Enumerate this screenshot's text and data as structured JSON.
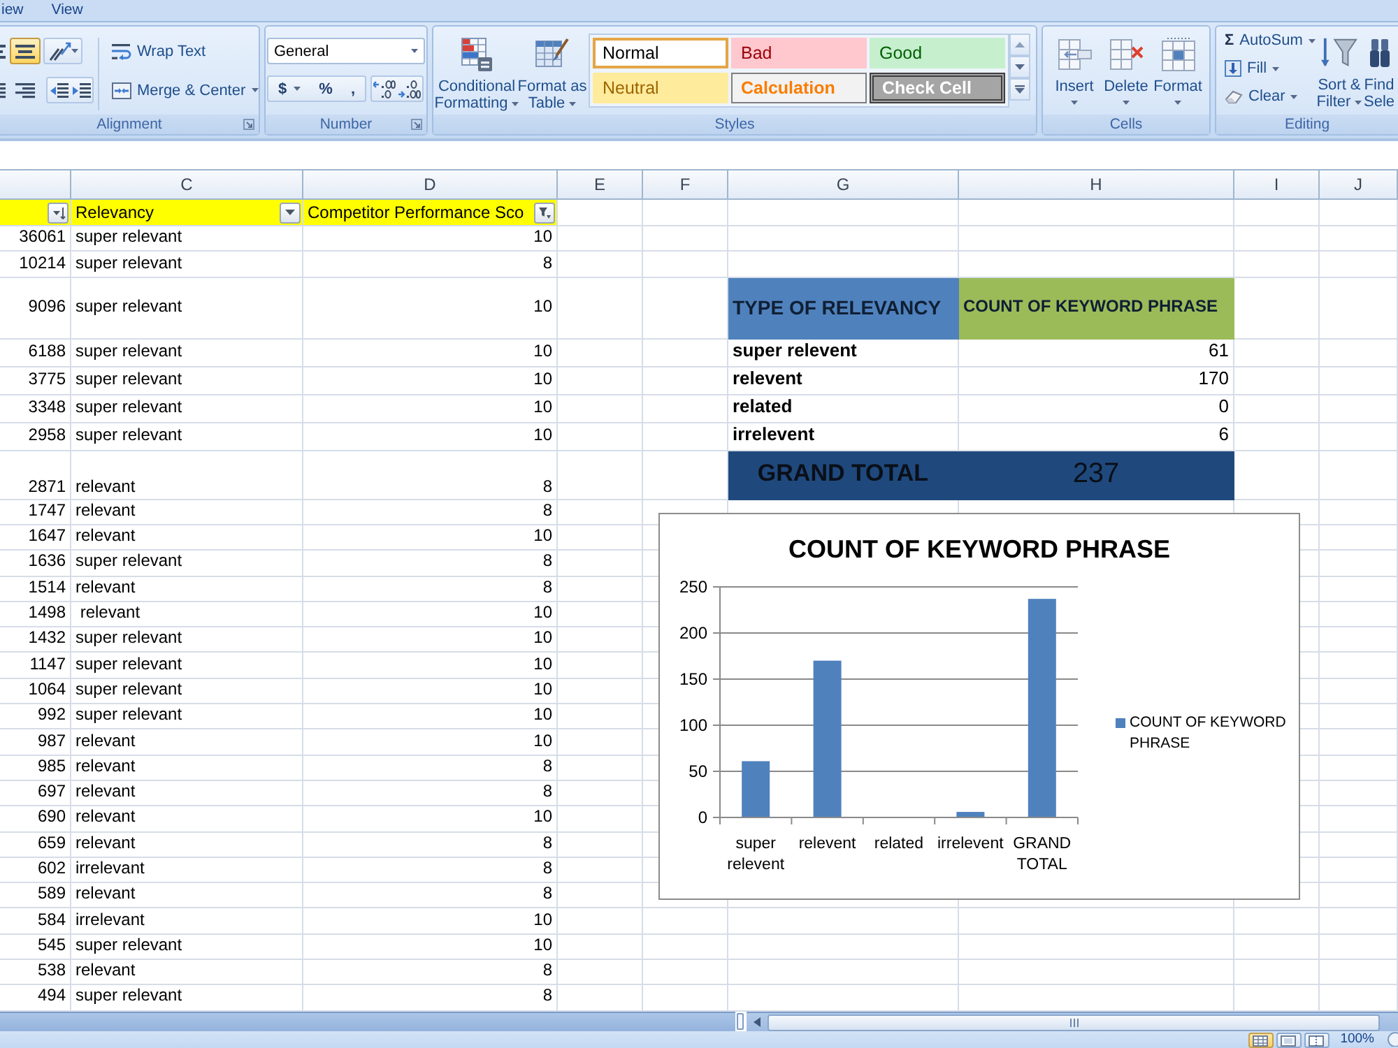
{
  "ribbon": {
    "tabs": [
      {
        "label": "iew",
        "selected": false
      },
      {
        "label": "View",
        "selected": false
      }
    ],
    "alignment": {
      "label": "Alignment",
      "vertical_align": [
        {
          "selected": false
        },
        {
          "selected": true
        }
      ],
      "horizontal_align": [
        {
          "selected": false
        },
        {
          "selected": false
        }
      ],
      "wrap_text": "Wrap Text",
      "merge_center": "Merge & Center"
    },
    "number": {
      "label": "Number",
      "format": "General",
      "currency": "$",
      "percent": "%",
      "comma": ","
    },
    "styles": {
      "label": "Styles",
      "conditional_formatting": [
        "Conditional",
        "Formatting"
      ],
      "format_as_table": [
        "Format as",
        "Table"
      ],
      "cell_styles": [
        {
          "label": "Normal",
          "kind": "normal",
          "selected": true
        },
        {
          "label": "Bad",
          "kind": "bad",
          "selected": false
        },
        {
          "label": "Good",
          "kind": "good",
          "selected": false
        },
        {
          "label": "Neutral",
          "kind": "neutral",
          "selected": false
        },
        {
          "label": "Calculation",
          "kind": "calculation",
          "selected": false
        },
        {
          "label": "Check Cell",
          "kind": "check",
          "selected": false
        }
      ]
    },
    "cells": {
      "label": "Cells",
      "buttons": [
        "Insert",
        "Delete",
        "Format"
      ]
    },
    "editing": {
      "label": "Editing",
      "autosum": {
        "symbol": "Σ",
        "label": "AutoSum"
      },
      "fill": "Fill",
      "clear": "Clear",
      "sort_filter": [
        "Sort &",
        "Filter"
      ],
      "find_select": [
        "Find",
        "Sele"
      ]
    }
  },
  "sheet": {
    "column_headers": [
      "C",
      "D",
      "E",
      "F",
      "G",
      "H",
      "I",
      "J"
    ],
    "filter_row": [
      {
        "kind": "sorted"
      },
      {
        "kind": "plain",
        "label": "Relevancy"
      },
      {
        "kind": "filtered",
        "label": "Competitor Performance Sco"
      }
    ],
    "rows": [
      {
        "kind": "data",
        "cells": {
          "B": "36061",
          "C": "super relevant",
          "D": "10"
        }
      },
      {
        "kind": "data",
        "cells": {
          "B": "10214",
          "C": "super relevant",
          "D": "8"
        }
      },
      {
        "kind": "summary-header",
        "cells": {
          "B": "9096",
          "C": "super relevant",
          "D": "10",
          "G": "TYPE OF RELEVANCY",
          "H": "COUNT OF KEYWORD PHRASE"
        }
      },
      {
        "kind": "summary-item",
        "cells": {
          "B": "6188",
          "C": "super relevant",
          "D": "10",
          "G": "super relevent",
          "H": "61"
        }
      },
      {
        "kind": "summary-item",
        "cells": {
          "B": "3775",
          "C": "super relevant",
          "D": "10",
          "G": "relevent",
          "H": "170"
        }
      },
      {
        "kind": "summary-item",
        "cells": {
          "B": "3348",
          "C": "super relevant",
          "D": "10",
          "G": "related",
          "H": "0"
        }
      },
      {
        "kind": "summary-item",
        "cells": {
          "B": "2958",
          "C": "super relevant",
          "D": "10",
          "G": "irrelevent",
          "H": "6"
        }
      },
      {
        "kind": "summary-total",
        "cells": {
          "B": "2871",
          "C": "relevant",
          "D": "8",
          "G": "GRAND TOTAL",
          "H": "237"
        }
      },
      {
        "kind": "data",
        "cells": {
          "B": "1747",
          "C": "relevant",
          "D": "8"
        }
      },
      {
        "kind": "data",
        "cells": {
          "B": "1647",
          "C": "relevant",
          "D": "10"
        }
      },
      {
        "kind": "data",
        "cells": {
          "B": "1636",
          "C": "super relevant",
          "D": "8"
        }
      },
      {
        "kind": "data",
        "cells": {
          "B": "1514",
          "C": "relevant",
          "D": "8"
        }
      },
      {
        "kind": "data",
        "cells": {
          "B": "1498",
          "C": " relevant",
          "D": "10"
        }
      },
      {
        "kind": "data",
        "cells": {
          "B": "1432",
          "C": "super relevant",
          "D": "10"
        }
      },
      {
        "kind": "data",
        "cells": {
          "B": "1147",
          "C": "super relevant",
          "D": "10"
        }
      },
      {
        "kind": "data",
        "cells": {
          "B": "1064",
          "C": "super relevant",
          "D": "10"
        }
      },
      {
        "kind": "data",
        "cells": {
          "B": "992",
          "C": "super relevant",
          "D": "10"
        }
      },
      {
        "kind": "data",
        "cells": {
          "B": "987",
          "C": "relevant",
          "D": "10"
        }
      },
      {
        "kind": "data",
        "cells": {
          "B": "985",
          "C": "relevant",
          "D": "8"
        }
      },
      {
        "kind": "data",
        "cells": {
          "B": "697",
          "C": "relevant",
          "D": "8"
        }
      },
      {
        "kind": "data",
        "cells": {
          "B": "690",
          "C": "relevant",
          "D": "10"
        }
      },
      {
        "kind": "data",
        "cells": {
          "B": "659",
          "C": "relevant",
          "D": "8"
        }
      },
      {
        "kind": "data",
        "cells": {
          "B": "602",
          "C": "irrelevant",
          "D": "8"
        }
      },
      {
        "kind": "data",
        "cells": {
          "B": "589",
          "C": "relevant",
          "D": "8"
        }
      },
      {
        "kind": "data",
        "cells": {
          "B": "584",
          "C": "irrelevant",
          "D": "10"
        }
      },
      {
        "kind": "data",
        "cells": {
          "B": "545",
          "C": "super relevant",
          "D": "10"
        }
      },
      {
        "kind": "data",
        "cells": {
          "B": "538",
          "C": "relevant",
          "D": "8"
        }
      },
      {
        "kind": "data",
        "cells": {
          "B": "494",
          "C": "super relevant",
          "D": "8"
        }
      }
    ]
  },
  "chart": {
    "chart_data": {
      "type": "bar",
      "title": "COUNT OF KEYWORD PHRASE",
      "categories": [
        "super relevent",
        "relevent",
        "related",
        "irrelevent",
        "GRAND TOTAL"
      ],
      "series": [
        {
          "name": "COUNT OF KEYWORD PHRASE",
          "color": "#4f81bd",
          "values": [
            61,
            170,
            0,
            6,
            237
          ]
        }
      ],
      "ylim": [
        0,
        250
      ],
      "yticks": [
        0,
        50,
        100,
        150,
        200,
        250
      ],
      "grid": true
    }
  },
  "status_bar": {
    "views": [
      {
        "selected": true
      },
      {
        "selected": false
      },
      {
        "selected": false
      }
    ],
    "zoom": "100%"
  }
}
